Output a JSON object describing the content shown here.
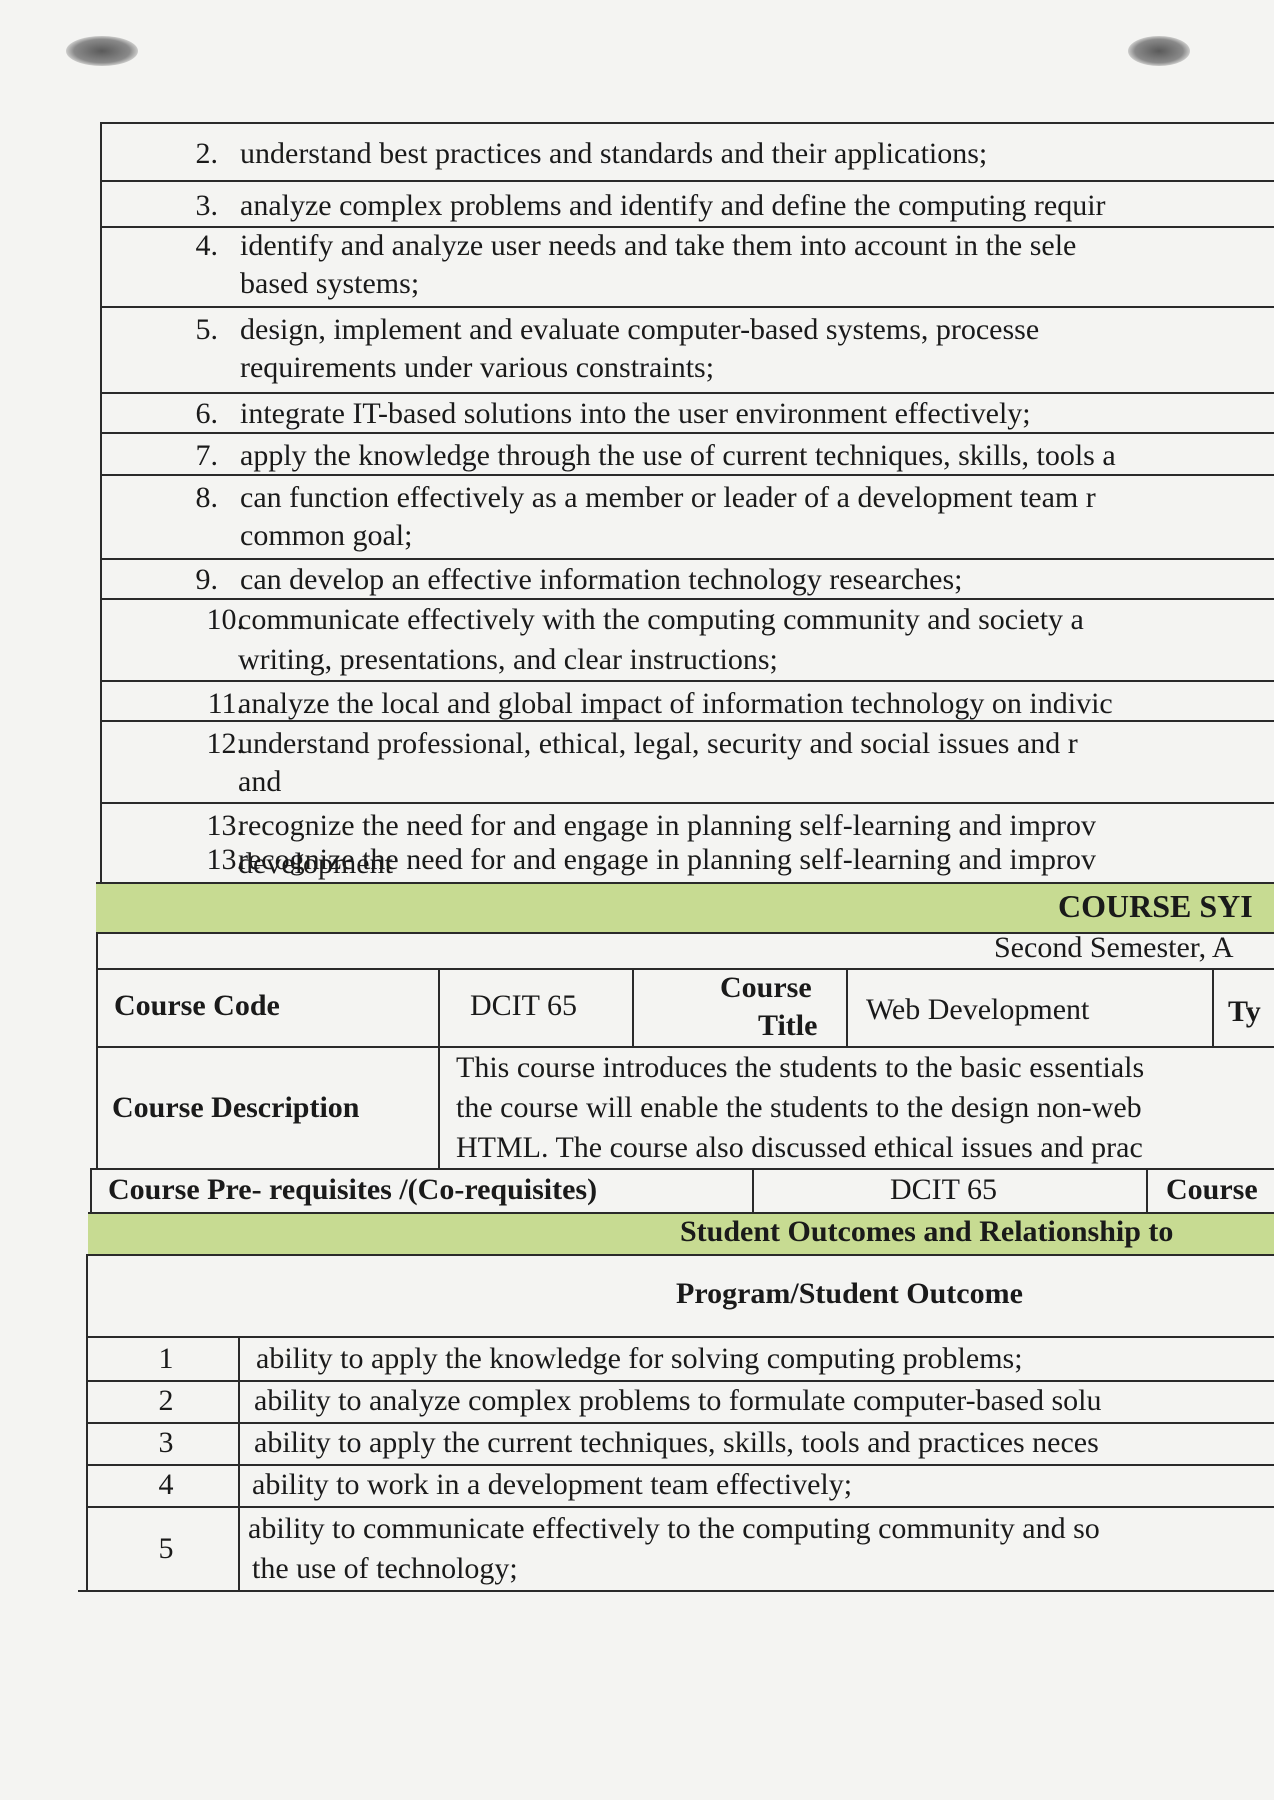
{
  "objectives": [
    {
      "num": "2.",
      "lines": [
        "understand best practices and standards and their applications;"
      ]
    },
    {
      "num": "3.",
      "lines": [
        "analyze complex problems and identify and define the computing requir"
      ]
    },
    {
      "num": "4.",
      "lines": [
        "identify and analyze user needs and take them into account in the sele",
        "based systems;"
      ]
    },
    {
      "num": "5.",
      "lines": [
        "design, implement and evaluate computer-based systems, processe",
        "requirements under various constraints;"
      ]
    },
    {
      "num": "6.",
      "lines": [
        "integrate IT-based solutions into the user environment effectively;"
      ]
    },
    {
      "num": "7.",
      "lines": [
        "apply the knowledge through the use of current techniques, skills, tools a"
      ]
    },
    {
      "num": "8.",
      "lines": [
        "can function effectively as  a member or leader of a development team r",
        "common goal;"
      ]
    },
    {
      "num": "9.",
      "lines": [
        "can develop an effective information technology researches;"
      ]
    },
    {
      "num": "10.",
      "lines": [
        "communicate effectively with the computing community and society a",
        "writing, presentations, and clear instructions;"
      ]
    },
    {
      "num": "11.",
      "lines": [
        "analyze the local and global impact of information technology on indivic"
      ]
    },
    {
      "num": "12.",
      "lines": [
        "understand professional, ethical, legal, security and social issues and r",
        "and"
      ]
    },
    {
      "num": "13.",
      "lines": [
        "recognize the need for and engage in planning self-learning and improv",
        "development"
      ]
    }
  ],
  "syllabus_header": {
    "title": "COURSE SYI",
    "subtitle": "Second Semester, A"
  },
  "course_info": {
    "code_label": "Course Code",
    "code_value": "DCIT 65",
    "title_label_1": "Course",
    "title_label_2": "Title",
    "title_value": "Web Development",
    "type_label": "Ty",
    "description_label": "Course Description",
    "description_lines": [
      "This course introduces the students to the basic essentials",
      "the course will enable the students to the design non-web",
      "HTML. The course also discussed ethical issues and prac"
    ],
    "prereq_label": "Course Pre- requisites /(Co-requisites)",
    "prereq_value": "DCIT 65",
    "prereq_next_label": "Course"
  },
  "outcomes_header": "Student Outcomes and Relationship to",
  "outcomes_column": "Program/Student Outcome",
  "outcomes": [
    {
      "num": "1",
      "lines": [
        "ability to apply the knowledge for solving computing problems;"
      ]
    },
    {
      "num": "2",
      "lines": [
        "ability to analyze complex problems to formulate computer-based solu"
      ]
    },
    {
      "num": "3",
      "lines": [
        "ability to apply the current techniques, skills, tools and practices neces"
      ]
    },
    {
      "num": "4",
      "lines": [
        "ability to work in a development team effectively;"
      ]
    },
    {
      "num": "5",
      "lines": [
        "ability to communicate effectively to the computing community and so",
        "the use of technology;"
      ]
    }
  ]
}
